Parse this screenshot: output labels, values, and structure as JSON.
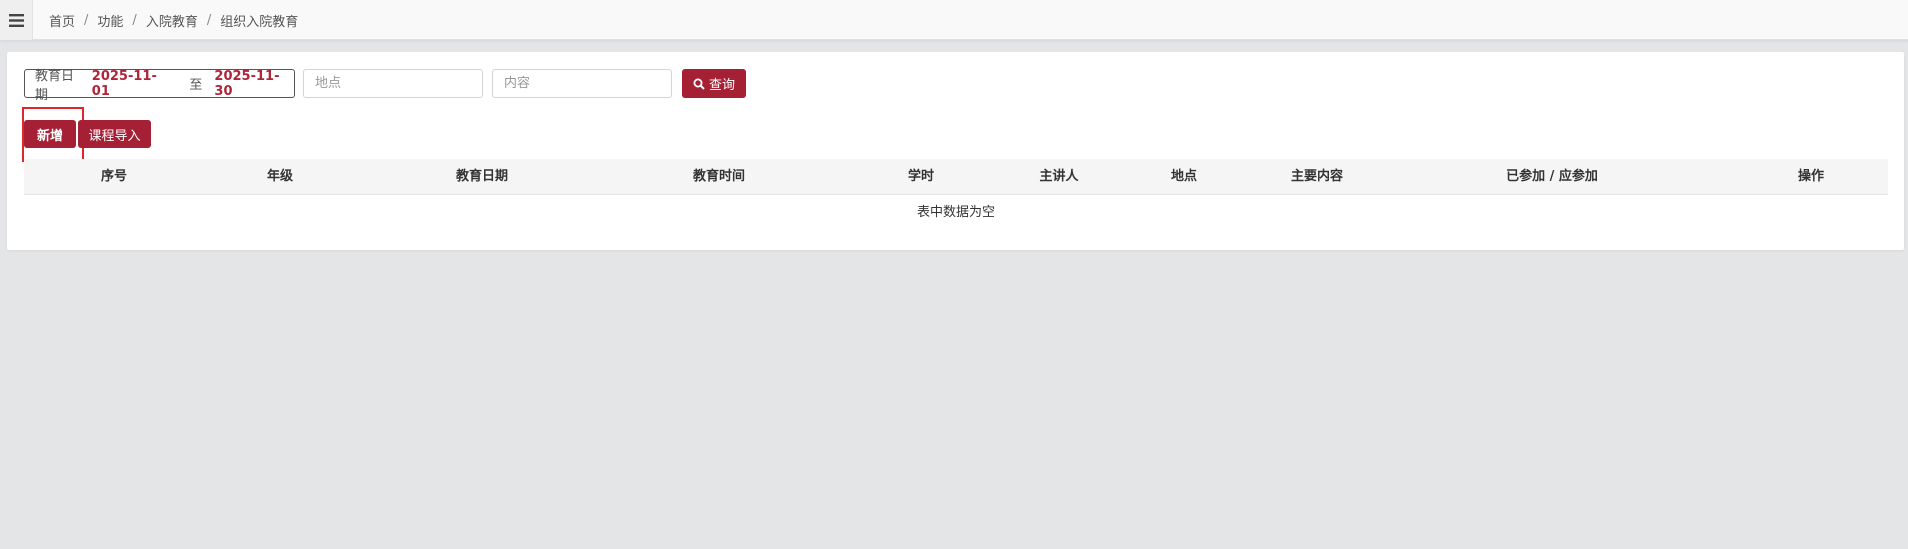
{
  "breadcrumb": [
    "首页",
    "功能",
    "入院教育",
    "组织入院教育"
  ],
  "filters": {
    "date_label": "教育日期",
    "date_start": "2025-11-01",
    "date_to": "至",
    "date_end": "2025-11-30",
    "location_placeholder": "地点",
    "content_placeholder": "内容",
    "search_label": "查询"
  },
  "actions": {
    "add_label": "新增",
    "import_label": "课程导入"
  },
  "table": {
    "columns": [
      "序号",
      "年级",
      "教育日期",
      "教育时间",
      "学时",
      "主讲人",
      "地点",
      "主要内容",
      "已参加 / 应参加",
      "操作"
    ],
    "empty_text": "表中数据为空"
  },
  "colors": {
    "accent": "#a51f35",
    "highlight_border": "#e0262c"
  },
  "icons": {
    "menu": "hamburger-menu-icon",
    "search": "search-icon"
  }
}
